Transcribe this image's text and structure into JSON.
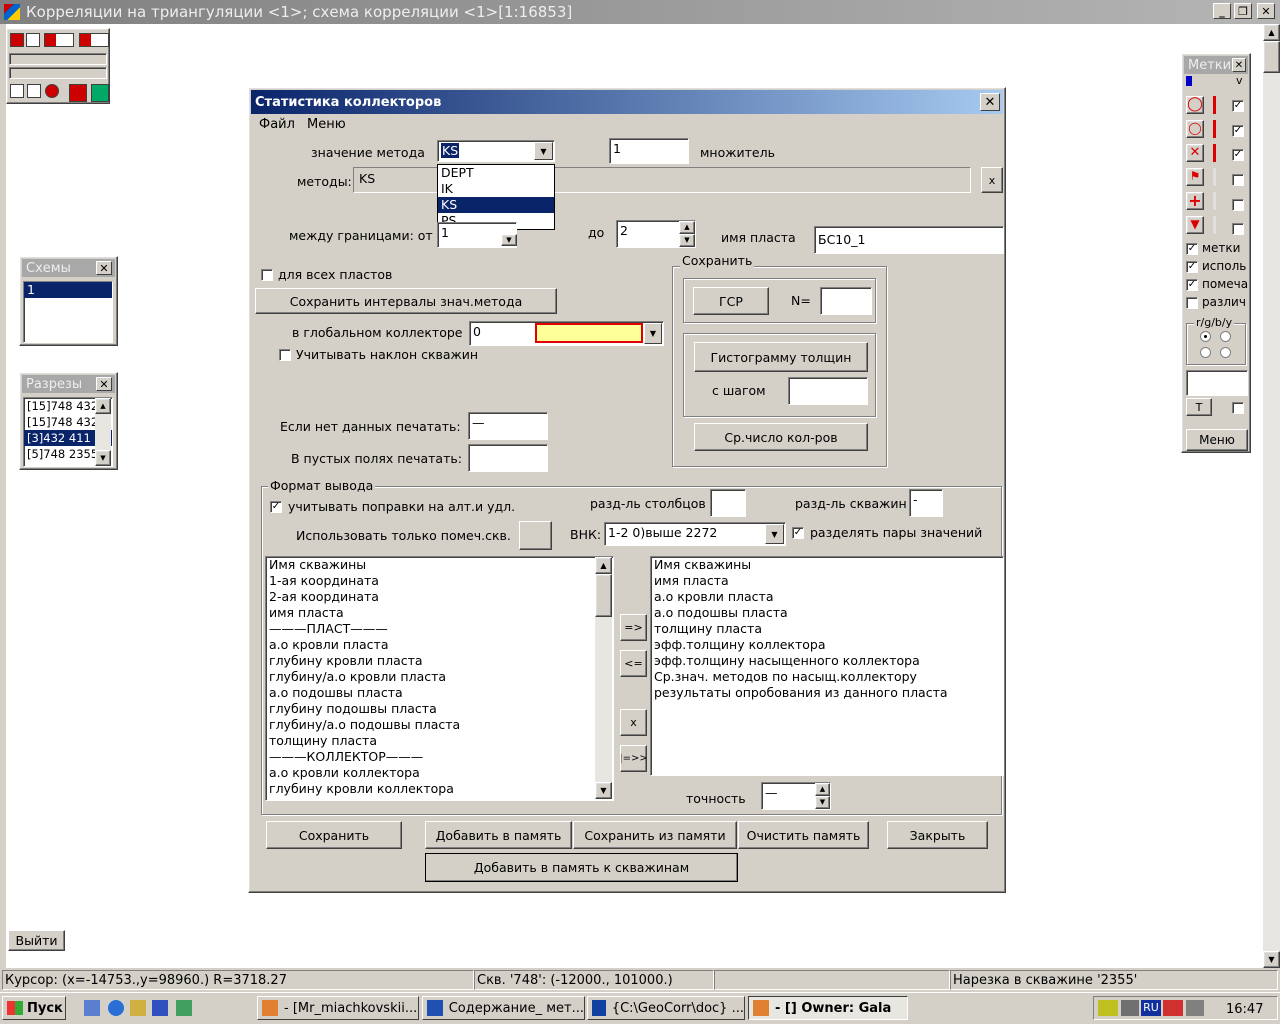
{
  "app": {
    "title": "Корреляции на триангуляции <1>; схема корреляции <1>[1:16853]",
    "exit_button": "Выйти"
  },
  "schemes_panel": {
    "title": "Схемы",
    "items": [
      "1"
    ]
  },
  "sections_panel": {
    "title": "Разрезы",
    "items": [
      "[15]748 432",
      "[15]748 432",
      "[3]432 411",
      "[5]748 2355"
    ]
  },
  "marks_panel": {
    "title": "Метки",
    "v_label": "v",
    "checks": [
      {
        "label": "метки",
        "checked": true
      },
      {
        "label": "исполь",
        "checked": true
      },
      {
        "label": "помеча",
        "checked": true
      },
      {
        "label": "различ",
        "checked": false
      }
    ],
    "rgb_label": "r/g/b/y",
    "t_button": "T",
    "menu_button": "Меню"
  },
  "dialog": {
    "title": "Статистика коллекторов",
    "menu": [
      "Файл",
      "Меню"
    ],
    "method_value_label": "значение метода",
    "method_value": "KS",
    "method_options": [
      "DEPT",
      "IK",
      "KS",
      "PS"
    ],
    "method_selected_index": 2,
    "multiplier_value": "1",
    "multiplier_label": "множитель",
    "methods_label": "методы:",
    "methods_value": "KS",
    "methods_clear": "x",
    "between_label": "между границами: от",
    "from_value": "1",
    "to_label": "до",
    "to_value": "2",
    "layer_name_label": "имя пласта",
    "layer_name_value": "БС10_1",
    "all_layers_label": "для всех пластов",
    "all_layers_checked": false,
    "save_intervals_button": "Сохранить интервалы знач.метода",
    "global_collector_label": "в глобальном коллекторе",
    "global_collector_value": "0",
    "incline_label": "Учитывать наклон скважин",
    "incline_checked": false,
    "no_data_label": "Если нет данных печатать:",
    "no_data_value": "—",
    "empty_fields_label": "В пустых полях печатать:",
    "empty_fields_value": "",
    "save_group": {
      "title": "Сохранить",
      "gsr_button": "ГСР",
      "n_label": "N=",
      "n_value": "",
      "histogram_button": "Гистограмму толщин",
      "step_label": "с шагом",
      "step_value": "",
      "avg_button": "Ср.число кол-ров"
    },
    "format_group": {
      "title": "Формат вывода",
      "corrections_label": "учитывать поправки на алт.и удл.",
      "corrections_checked": true,
      "col_sep_label": "разд-ль столбцов",
      "col_sep_value": "",
      "well_sep_label": "разд-ль скважин",
      "well_sep_value": "-",
      "only_marked_label": "Использовать только помеч.скв.",
      "vnk_label": "ВНК:",
      "vnk_value": "1-2  0)выше 2272",
      "split_pairs_label": "разделять пары значений",
      "split_pairs_checked": true,
      "left_list": [
        "Имя скважины",
        "1-ая координата",
        "2-ая координата",
        "имя пласта",
        "———ПЛАСТ———",
        "а.о кровли пласта",
        "глубину кровли пласта",
        "глубину/а.о кровли пласта",
        "а.о подошвы пласта",
        "глубину подошвы пласта",
        "глубину/а.о подошвы пласта",
        "толщину пласта",
        "———КОЛЛЕКТОР———",
        "а.о кровли коллектора",
        "глубину кровли коллектора"
      ],
      "right_list": [
        "Имя скважины",
        "имя пласта",
        "а.о кровли пласта",
        "а.о подошвы пласта",
        "толщину пласта",
        "эфф.толщину коллектора",
        "эфф.толщину насыщенного коллектора",
        "Ср.знач. методов по насыщ.коллектору",
        "результаты опробования из данного пласта"
      ],
      "move_right": "=>",
      "move_left": "<=",
      "remove": "x",
      "move_all": "|=>>",
      "precision_label": "точность",
      "precision_value": "—"
    },
    "buttons": {
      "save": "Сохранить",
      "add_memory": "Добавить в память",
      "save_from_memory": "Сохранить из памяти",
      "clear_memory": "Очистить память",
      "close": "Закрыть",
      "add_memory_wells": "Добавить в память к скважинам"
    }
  },
  "status_bar": {
    "cursor": "Курсор: (x=-14753.,y=98960.) R=3718.27",
    "well": "Скв. '748': (-12000., 101000.)",
    "empty": "",
    "cut": "Нарезка в скважине '2355'"
  },
  "taskbar": {
    "start": "Пуск",
    "items": [
      "- [Mr_miachkovskii...",
      "Содержание_ мет...",
      "{C:\\GeoCorr\\doc} ...",
      "- [] Owner: Gala"
    ],
    "lang": "RU",
    "clock": "16:47"
  }
}
